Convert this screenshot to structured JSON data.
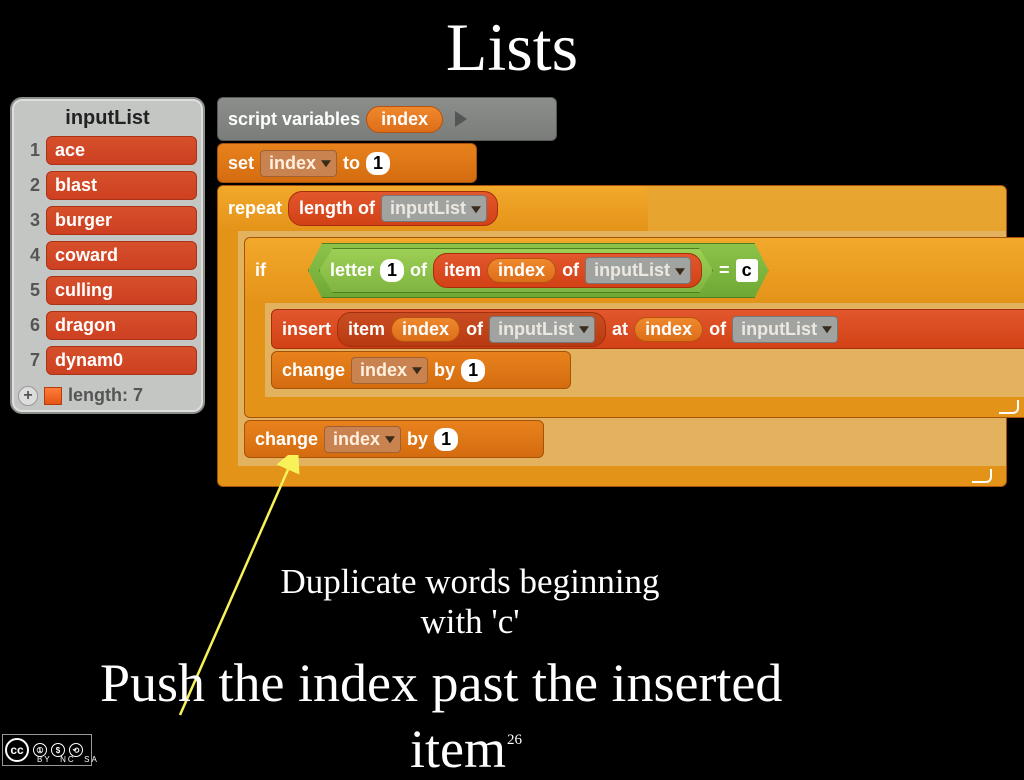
{
  "slide": {
    "title": "Lists",
    "caption1": "Duplicate words beginning with 'c'",
    "caption2": "Push the index past the inserted",
    "caption3": "item",
    "number": "26"
  },
  "list": {
    "title": "inputList",
    "items": [
      "ace",
      "blast",
      "burger",
      "coward",
      "culling",
      "dragon",
      "dynam0"
    ],
    "nums": [
      "1",
      "2",
      "3",
      "4",
      "5",
      "6",
      "7"
    ],
    "length_label": "length: 7"
  },
  "blocks": {
    "script_variables": "script variables",
    "var_index": "index",
    "set": "set",
    "to": "to",
    "one": "1",
    "repeat": "repeat",
    "length_of": "length of",
    "inputList": "inputList",
    "if": "if",
    "letter": "letter",
    "of": "of",
    "item": "item",
    "equals": "=",
    "c": "c",
    "insert": "insert",
    "at": "at",
    "change": "change",
    "by": "by"
  },
  "cc": {
    "cc": "cc",
    "by": "BY",
    "nc": "NC",
    "sa": "SA"
  }
}
